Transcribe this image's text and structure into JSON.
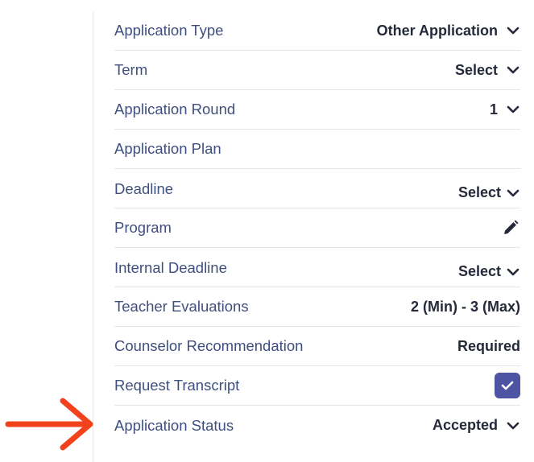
{
  "rows": [
    {
      "label": "Application Type",
      "value": "Other Application"
    },
    {
      "label": "Term",
      "value": "Select"
    },
    {
      "label": "Application Round",
      "value": "1"
    },
    {
      "label": "Application Plan",
      "value": ""
    },
    {
      "label": "Deadline",
      "value": "Select"
    },
    {
      "label": "Program",
      "value": ""
    },
    {
      "label": "Internal Deadline",
      "value": "Select"
    },
    {
      "label": "Teacher Evaluations",
      "value": "2 (Min) - 3 (Max)"
    },
    {
      "label": "Counselor Recommendation",
      "value": "Required"
    },
    {
      "label": "Request Transcript",
      "checked": true
    },
    {
      "label": "Application Status",
      "value": "Accepted"
    }
  ],
  "colors": {
    "label": "#3f4f7f",
    "value": "#252a3a",
    "divider": "#e3e5ea",
    "checkbox": "#4d55a3",
    "arrow": "#f1421d"
  },
  "icons": {
    "dropdown": "chevron-down-icon",
    "edit": "pencil-icon",
    "check": "checkmark-icon",
    "pointer": "arrow-right-icon"
  }
}
